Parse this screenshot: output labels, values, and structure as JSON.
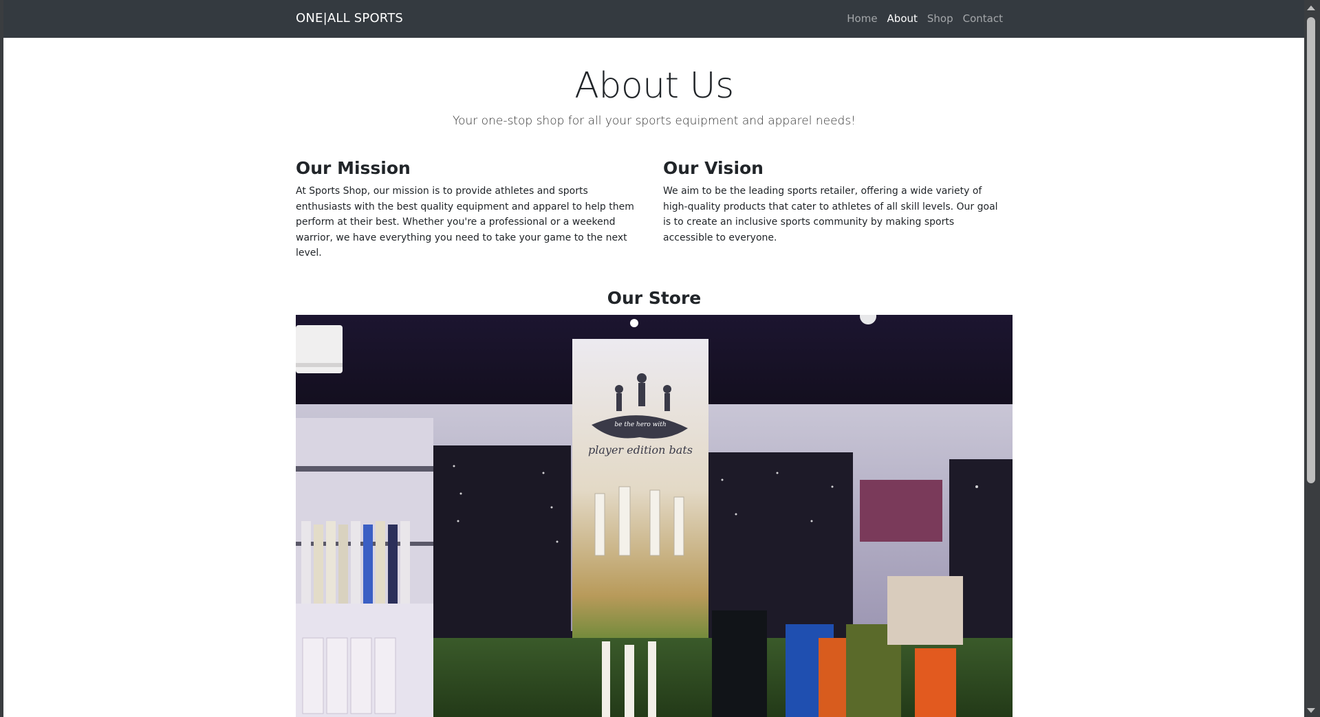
{
  "navbar": {
    "brand": "ONE|ALL SPORTS",
    "links": [
      {
        "label": "Home",
        "active": false
      },
      {
        "label": "About",
        "active": true
      },
      {
        "label": "Shop",
        "active": false
      },
      {
        "label": "Contact",
        "active": false
      }
    ]
  },
  "hero": {
    "title": "About Us",
    "lead": "Your one-stop shop for all your sports equipment and apparel needs!"
  },
  "mission": {
    "title": "Our Mission",
    "text": "At Sports Shop, our mission is to provide athletes and sports enthusiasts with the best quality equipment and apparel to help them perform at their best. Whether you're a professional or a weekend warrior, we have everything you need to take your game to the next level."
  },
  "vision": {
    "title": "Our Vision",
    "text": "We aim to be the leading sports retailer, offering a wide variety of high-quality products that cater to athletes of all skill levels. Our goal is to create an inclusive sports community by making sports accessible to everyone."
  },
  "store": {
    "title": "Our Store",
    "banner_line1": "be the hero with",
    "banner_line2": "player edition bats"
  },
  "colors": {
    "navbar_bg": "#343a40",
    "nav_active": "#ffffff",
    "nav_inactive": "rgba(255,255,255,0.55)",
    "text": "#212529"
  }
}
